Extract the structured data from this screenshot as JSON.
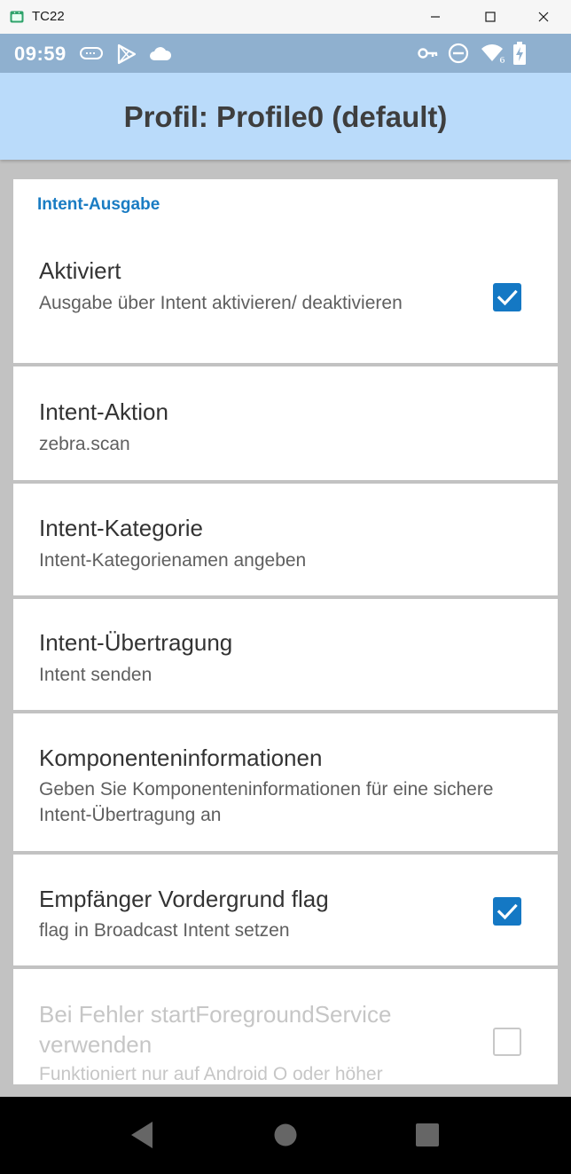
{
  "window": {
    "title": "TC22"
  },
  "status_bar": {
    "time": "09:59"
  },
  "action_bar": {
    "title": "Profil: Profile0 (default)"
  },
  "section": {
    "title": "Intent-Ausgabe"
  },
  "rows": [
    {
      "title": "Aktiviert",
      "subtitle": "Ausgabe über Intent aktivieren/ deaktivieren",
      "checkbox": "checked"
    },
    {
      "title": "Intent-Aktion",
      "subtitle": "zebra.scan"
    },
    {
      "title": "Intent-Kategorie",
      "subtitle": "Intent-Kategorienamen angeben"
    },
    {
      "title": "Intent-Übertragung",
      "subtitle": "Intent senden"
    },
    {
      "title": "Komponenteninformationen",
      "subtitle": "Geben Sie Komponenteninformationen für eine sichere Intent-Übertragung an"
    },
    {
      "title": "Empfänger Vordergrund flag",
      "subtitle": "flag in Broadcast Intent setzen",
      "checkbox": "checked"
    },
    {
      "title": "Bei Fehler startForegroundService verwenden",
      "subtitle": "Funktioniert nur auf Android O oder höher",
      "checkbox": "unchecked",
      "state": "disabled"
    }
  ],
  "colors": {
    "status_bar": "#8fb0cf",
    "action_bar": "#badbfa",
    "accent": "#1478c4",
    "section_title": "#1a7cc3",
    "background": "#c2c2c2"
  },
  "icons": {
    "status_bar": [
      "data-saver-icon",
      "play-store-icon",
      "cloud-icon",
      "vpn-key-icon",
      "do-not-disturb-icon",
      "wifi-6-icon",
      "battery-charging-icon"
    ],
    "navigation": [
      "back-icon",
      "home-icon",
      "recents-icon"
    ],
    "window": [
      "minimize-icon",
      "maximize-icon",
      "close-icon"
    ]
  }
}
